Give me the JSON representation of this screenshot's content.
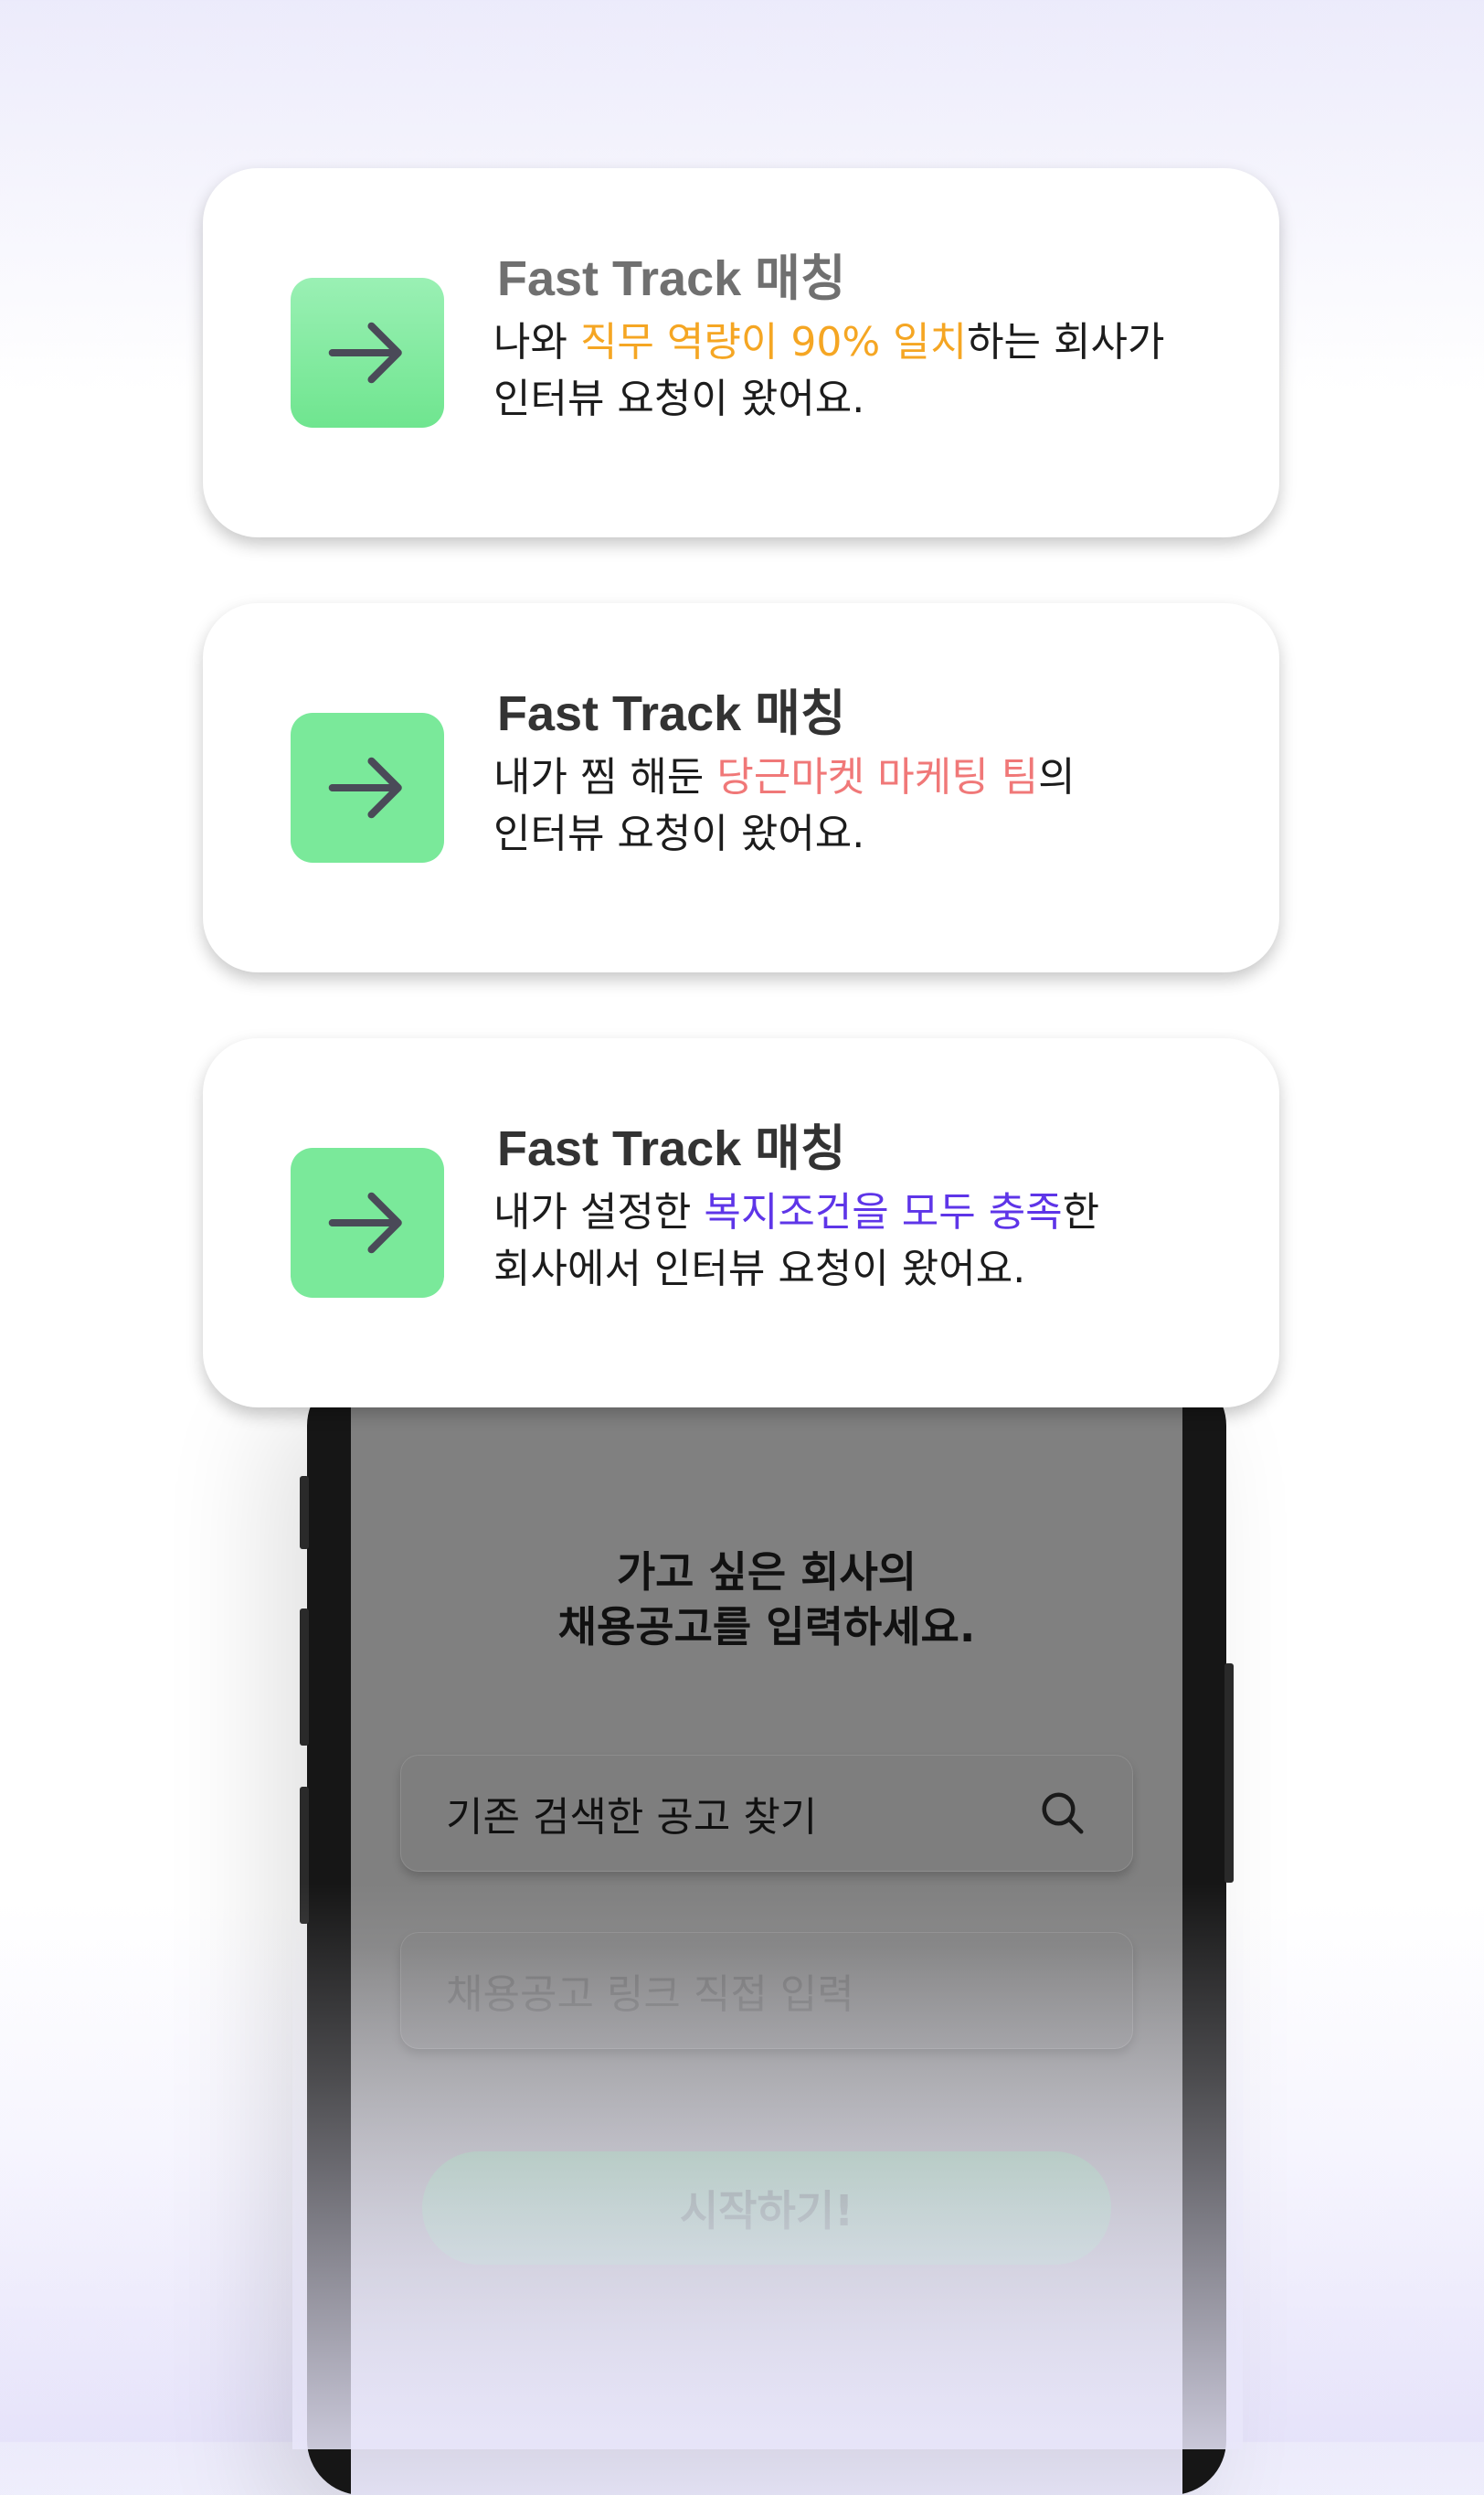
{
  "cards": [
    {
      "title": "Fast Track 매칭",
      "line1_before": "나와 ",
      "line1_highlight": "직무 역량이 90% 일치",
      "line1_after": "하는 회사가",
      "line2": "인터뷰 요청이 왔어요.",
      "highlight_color": "#f5a623",
      "icon": "arrow-right-icon"
    },
    {
      "title": "Fast Track 매칭",
      "line1_before": "내가 찜 해둔 ",
      "line1_highlight": "당근마켓 마케팅 팀",
      "line1_after": "의",
      "line2": "인터뷰 요청이 왔어요.",
      "highlight_color": "#f07878",
      "icon": "arrow-right-icon"
    },
    {
      "title": "Fast Track 매칭",
      "line1_before": "내가 설정한 ",
      "line1_highlight": "복지조건을 모두 충족",
      "line1_after": "한",
      "line2": "회사에서 인터뷰 요청이 왔어요.",
      "highlight_color": "#5e35e8",
      "icon": "arrow-right-icon"
    }
  ],
  "screen": {
    "heading_line1": "가고 싶은 회사의",
    "heading_line2": "채용공고를 입력하세요.",
    "search_field_label": "기존 검색한 공고 찾기",
    "link_field_placeholder": "채용공고 링크 직접 입력",
    "start_button": "시작하기!"
  },
  "colors": {
    "accent_green": "#7ae99a",
    "start_button": "#6f9f7e",
    "screen_overlay": "#808080"
  }
}
